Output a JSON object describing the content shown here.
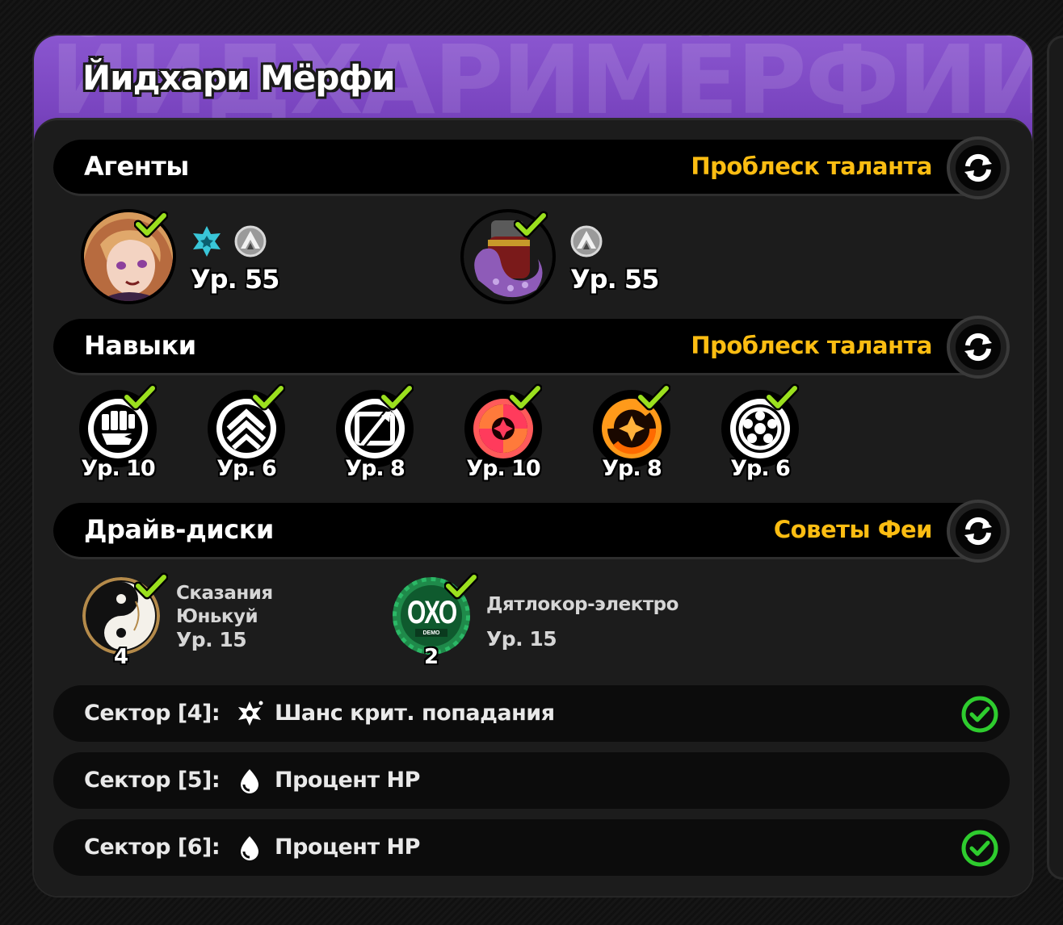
{
  "header": {
    "title": "Йидхари Мёрфи",
    "watermark": "ЙИДХАРИМЁРФИЙИДХАРИ"
  },
  "colors": {
    "header_purple": "#7a45c0",
    "accent_yellow": "#fcbd12",
    "check_lime": "#9be01e",
    "sector_check_green": "#2ecc2e"
  },
  "agents_section": {
    "title": "Агенты",
    "action": "Проблеск таланта",
    "refresh_icon": "refresh-icon",
    "agents": [
      {
        "avatar": "agent-portrait-blonde",
        "icons": [
          "ether-star-icon",
          "rank-emblem-icon"
        ],
        "level": "Ур. 55"
      },
      {
        "avatar": "bangboo-tentacle-portrait",
        "icons": [
          "rank-emblem-icon"
        ],
        "level": "Ур. 55"
      }
    ]
  },
  "skills_section": {
    "title": "Навыки",
    "action": "Проблеск таланта",
    "skills": [
      {
        "icon": "basic-attack-fist-icon",
        "level": "Ур. 10"
      },
      {
        "icon": "dodge-chevrons-icon",
        "level": "Ур. 6"
      },
      {
        "icon": "assist-arrows-icon",
        "level": "Ур. 8"
      },
      {
        "icon": "special-attack-icon",
        "level": "Ур. 10"
      },
      {
        "icon": "chain-attack-icon",
        "level": "Ур. 8"
      },
      {
        "icon": "core-skill-icon",
        "level": "Ур. 6"
      }
    ]
  },
  "drive_discs_section": {
    "title": "Драйв-диски",
    "action": "Советы Феи",
    "discs": [
      {
        "icon": "yunkui-disc-icon",
        "name_line1": "Сказания",
        "name_line2": "Юнькуй",
        "level": "Ур. 15",
        "count": "4"
      },
      {
        "icon": "oxo-disc-icon",
        "badge": "OXO",
        "badge_small": "DEMO",
        "name_line1": "Дятлокор-электро",
        "level": "Ур. 15",
        "count": "2"
      }
    ]
  },
  "sectors": [
    {
      "label": "Сектор [4]:",
      "icon": "crit-rate-icon",
      "value": "Шанс крит. попадания",
      "checked": true
    },
    {
      "label": "Сектор [5]:",
      "icon": "hp-drop-icon",
      "value": "Процент HP",
      "checked": false
    },
    {
      "label": "Сектор [6]:",
      "icon": "hp-drop-icon",
      "value": "Процент HP",
      "checked": true
    }
  ]
}
